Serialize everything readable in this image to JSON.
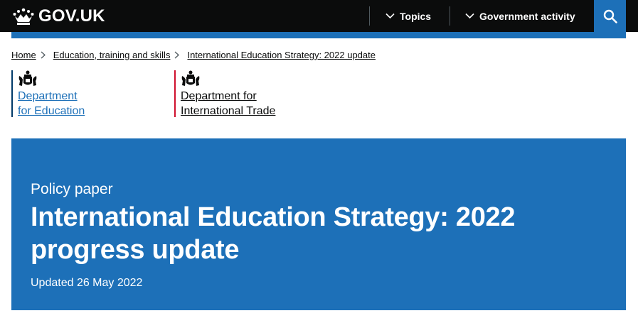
{
  "header": {
    "logo_text": "GOV.UK",
    "nav": [
      {
        "label": "Topics"
      },
      {
        "label": "Government activity"
      }
    ],
    "accent_color": "#1d70b8",
    "icons": {
      "logo": "crown-icon",
      "search": "search-icon",
      "chevron": "chevron-down-icon"
    }
  },
  "breadcrumb": {
    "items": [
      {
        "label": "Home"
      },
      {
        "label": "Education, training and skills"
      },
      {
        "label": "International Education Strategy: 2022 update"
      }
    ]
  },
  "organisations": [
    {
      "line1": "Department",
      "line2": "for Education",
      "brand_color": "#003a69"
    },
    {
      "line1": "Department for",
      "line2": "International Trade",
      "brand_color": "#cf102d"
    }
  ],
  "hero": {
    "document_type": "Policy paper",
    "title": "International Education Strategy: 2022 progress update",
    "updated": "Updated 26 May 2022"
  }
}
